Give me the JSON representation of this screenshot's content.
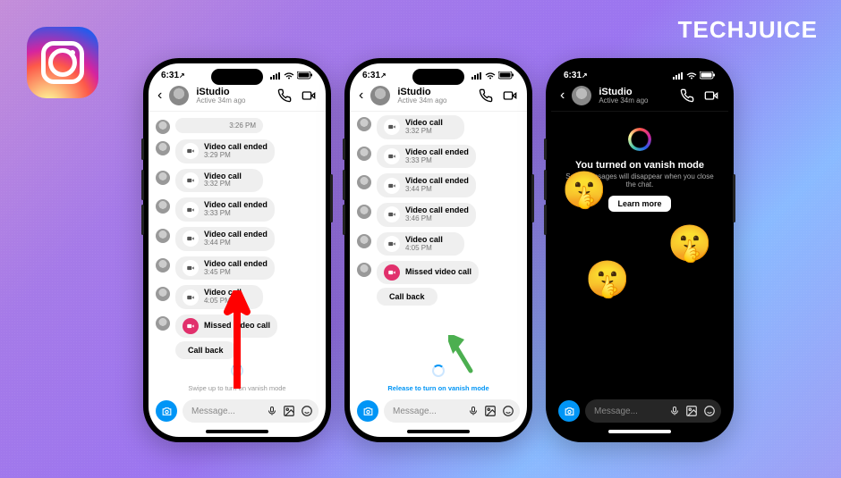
{
  "brand": "TECHJUICE",
  "statusbar": {
    "time": "6:31",
    "loc_indicator": "◀"
  },
  "chat": {
    "user_name": "iStudio",
    "user_status": "Active 34m ago",
    "message_placeholder": "Message..."
  },
  "phone1": {
    "messages": [
      {
        "kind": "time_only",
        "time": "3:26 PM"
      },
      {
        "kind": "ended",
        "title": "Video call ended",
        "time": "3:29 PM"
      },
      {
        "kind": "start",
        "title": "Video call",
        "time": "3:32 PM"
      },
      {
        "kind": "ended",
        "title": "Video call ended",
        "time": "3:33 PM"
      },
      {
        "kind": "ended",
        "title": "Video call ended",
        "time": "3:44 PM"
      },
      {
        "kind": "ended",
        "title": "Video call ended",
        "time": "3:45 PM"
      },
      {
        "kind": "start",
        "title": "Video call",
        "time": "4:05 PM"
      },
      {
        "kind": "missed",
        "title": "Missed video call"
      }
    ],
    "callback": "Call back",
    "hint": "Swipe up to turn on vanish mode"
  },
  "phone2": {
    "messages": [
      {
        "kind": "start",
        "title": "Video call",
        "time": "3:32 PM"
      },
      {
        "kind": "ended",
        "title": "Video call ended",
        "time": "3:33 PM"
      },
      {
        "kind": "ended",
        "title": "Video call ended",
        "time": "3:44 PM"
      },
      {
        "kind": "ended",
        "title": "Video call ended",
        "time": "3:46 PM"
      },
      {
        "kind": "start",
        "title": "Video call",
        "time": "4:05 PM"
      },
      {
        "kind": "missed",
        "title": "Missed video call"
      }
    ],
    "callback": "Call back",
    "hint": "Release to turn on vanish mode"
  },
  "phone3": {
    "vanish_title": "You turned on vanish mode",
    "vanish_sub": "Seen messages will disappear when you close the chat.",
    "learn_more": "Learn more"
  },
  "icons": {
    "back": "‹"
  }
}
